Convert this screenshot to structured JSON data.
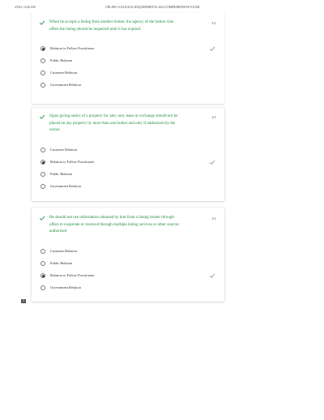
{
  "header": {
    "datetime": "2/9/23, 10:20 AM",
    "title": "ONLINE COLLEGIAL REQUIREMENTS 2024 COMPREHENSIVE EXAM"
  },
  "questions": [
    {
      "text": "When he accepts a listing from another broker, the agency of the broker who offers the listing should be respected until it has expired.",
      "score": "1/1",
      "options": [
        {
          "label": "Relation to Follow Practitioner",
          "selected": true,
          "correct": true
        },
        {
          "label": "Public Relation",
          "selected": false,
          "correct": false
        },
        {
          "label": "Customer Relation",
          "selected": false,
          "correct": false
        },
        {
          "label": "Government Relation",
          "selected": false,
          "correct": false
        }
      ]
    },
    {
      "text": "Signs giving notice of a property for sale, rent, lease or exchange should not be placed on any property by more than one broker and only if authorized by the owner.",
      "score": "1/1",
      "options": [
        {
          "label": "Customer Relation",
          "selected": false,
          "correct": false
        },
        {
          "label": "Relation to Follow Practitioner",
          "selected": true,
          "correct": true
        },
        {
          "label": "Public Relation",
          "selected": false,
          "correct": false
        },
        {
          "label": "Government Relation",
          "selected": false,
          "correct": false
        }
      ]
    },
    {
      "text": "He should not use information obtained by him from a listing broker through offers to cooperate or received through multiple listing services or other sources authorized",
      "score": "1/1",
      "options": [
        {
          "label": "Customer Relation",
          "selected": false,
          "correct": false
        },
        {
          "label": "Public Relation",
          "selected": false,
          "correct": false
        },
        {
          "label": "Relation to Follow Practitioner",
          "selected": true,
          "correct": true
        },
        {
          "label": "Government Relation",
          "selected": false,
          "correct": false
        }
      ]
    }
  ],
  "footer": {
    "page_number": "3"
  },
  "colors": {
    "correct": "#1e8e3e",
    "text": "#333333"
  }
}
